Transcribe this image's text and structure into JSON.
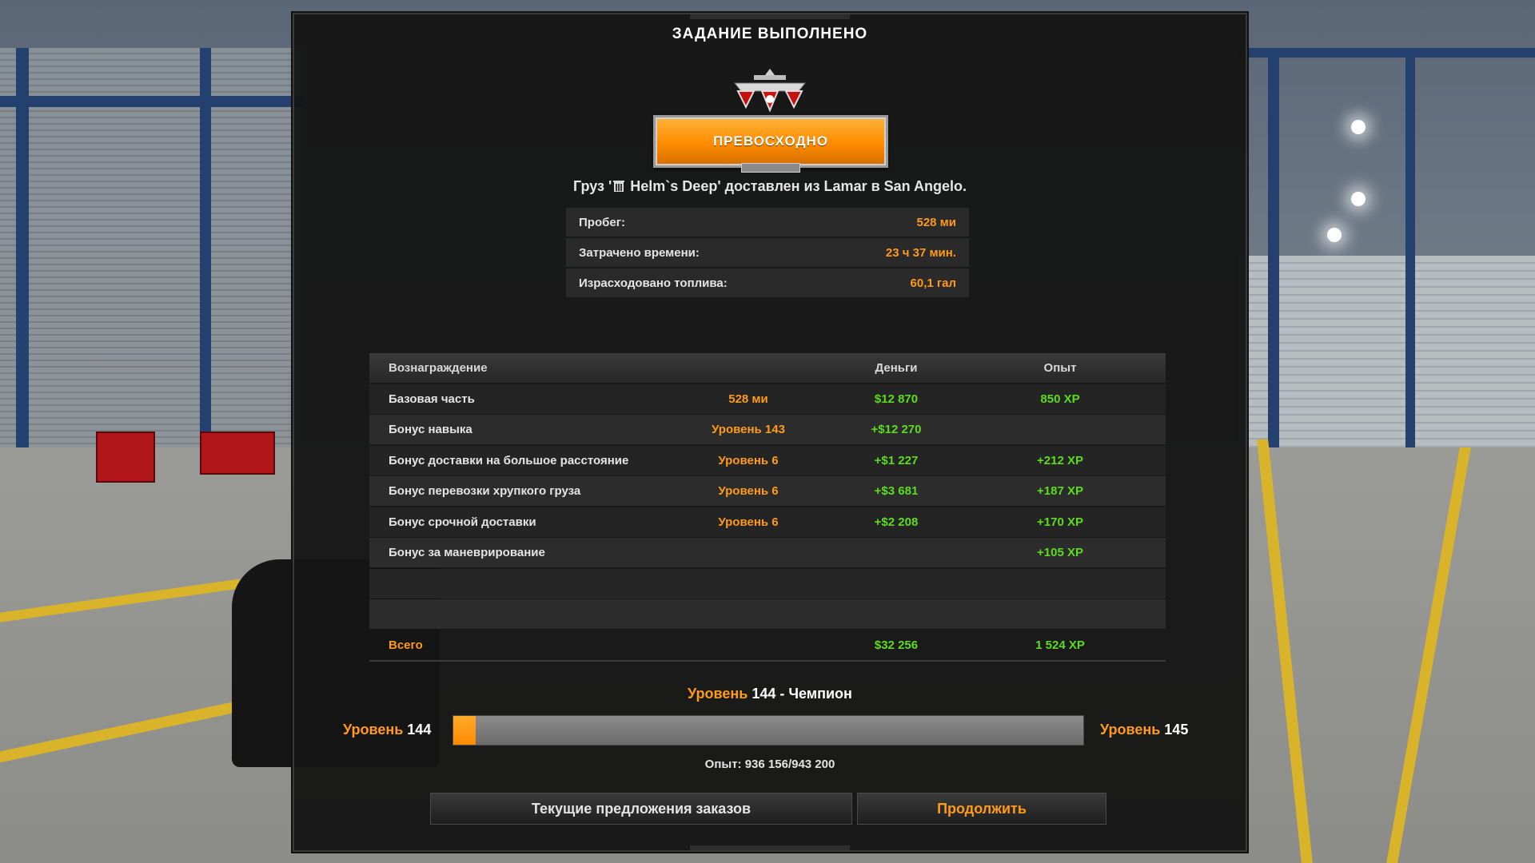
{
  "title": "ЗАДАНИЕ ВЫПОЛНЕНО",
  "rating": "ПРЕВОСХОДНО",
  "delivery": {
    "prefix": "Груз '",
    "cargo": "Helm`s Deep",
    "suffix": "' доставлен из Lamar в San Angelo."
  },
  "stats": [
    {
      "label": "Пробег:",
      "value": "528 ми"
    },
    {
      "label": "Затрачено времени:",
      "value": "23 ч 37 мин."
    },
    {
      "label": "Израсходовано топлива:",
      "value": "60,1 гал"
    }
  ],
  "rewards": {
    "headers": {
      "name": "Вознаграждение",
      "money": "Деньги",
      "xp": "Опыт"
    },
    "rows": [
      {
        "name": "Базовая часть",
        "level": "528 ми",
        "money": "$12 870",
        "xp": "850 XP"
      },
      {
        "name": "Бонус навыка",
        "level": "Уровень 143",
        "money": "+$12 270",
        "xp": ""
      },
      {
        "name": "Бонус доставки на большое расстояние",
        "level": "Уровень 6",
        "money": "+$1 227",
        "xp": "+212 XP"
      },
      {
        "name": "Бонус перевозки хрупкого груза",
        "level": "Уровень 6",
        "money": "+$3 681",
        "xp": "+187 XP"
      },
      {
        "name": "Бонус срочной доставки",
        "level": "Уровень 6",
        "money": "+$2 208",
        "xp": "+170 XP"
      },
      {
        "name": "Бонус за маневрирование",
        "level": "",
        "money": "",
        "xp": "+105 XP"
      }
    ],
    "total": {
      "name": "Всего",
      "money": "$32 256",
      "xp": "1 524 XP"
    }
  },
  "level": {
    "word": "Уровень",
    "current": "144",
    "title_rest": " - Чемпион",
    "next": "145",
    "progress_fraction": 0.035,
    "xp_line": "Опыт: 936 156/943 200"
  },
  "buttons": {
    "offers": "Текущие предложения заказов",
    "continue": "Продолжить"
  },
  "colors": {
    "accent": "#ff9a1a",
    "positive": "#5cdc1e",
    "panel": "#161616"
  }
}
